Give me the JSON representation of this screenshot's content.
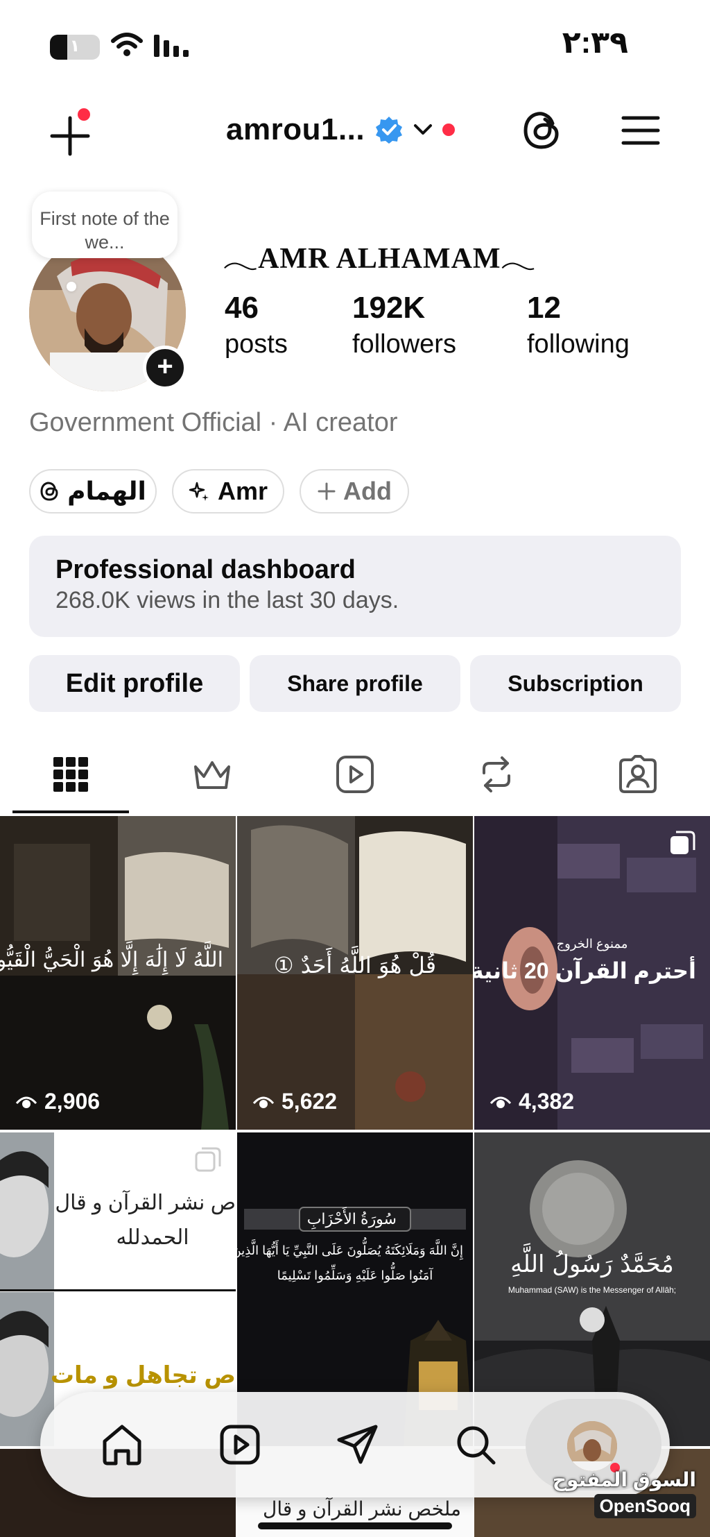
{
  "status_bar": {
    "time": "٢:٣٩",
    "battery_label": "١",
    "battery_level": 0.35
  },
  "header": {
    "username": "amrou1...",
    "verified_icon": "verified-badge-icon",
    "dropdown_icon": "chevron-down-icon",
    "create_icon": "plus-icon",
    "threads_icon": "threads-icon",
    "menu_icon": "hamburger-menu-icon"
  },
  "profile": {
    "note_text": "First note of the we...",
    "display_name": "𓂃AMR ALHAMAM𓂃",
    "stats": [
      {
        "value": "46",
        "label": "posts"
      },
      {
        "value": "192K",
        "label": "followers"
      },
      {
        "value": "12",
        "label": "following"
      }
    ],
    "category": "Government Official · AI creator"
  },
  "chips": [
    {
      "label": "الهمام",
      "icon": "threads-icon"
    },
    {
      "label": "Amr",
      "icon": "sparkle-icon"
    },
    {
      "label": "Add",
      "icon": "plus-icon"
    }
  ],
  "dashboard": {
    "title": "Professional dashboard",
    "subtitle": "268.0K views in the last 30 days."
  },
  "actions": {
    "edit": "Edit profile",
    "share": "Share profile",
    "subscription": "Subscription"
  },
  "tabs": [
    {
      "name": "posts",
      "icon": "grid-icon",
      "active": true
    },
    {
      "name": "subscriptions",
      "icon": "crown-icon",
      "active": false
    },
    {
      "name": "reels",
      "icon": "reels-icon",
      "active": false
    },
    {
      "name": "reposts",
      "icon": "repost-icon",
      "active": false
    },
    {
      "name": "tagged",
      "icon": "tagged-icon",
      "active": false
    }
  ],
  "grid": [
    {
      "views": "2,906",
      "caption": "اللَّهُ لَا إِلَٰهَ إِلَّا هُوَ الْحَيُّ الْقَيُّومُ"
    },
    {
      "views": "5,622",
      "caption": "قُلْ هُوَ اللَّهُ أَحَدٌ ①"
    },
    {
      "views": "4,382",
      "caption": "أحترم القرآن 20 ثانية",
      "small": "ممنوع الخروج"
    },
    {
      "caption": "ص نشر القرآن و قال",
      "caption2": "الحمدلله",
      "caption3": "ص تجاهل و مات"
    },
    {
      "caption": "سُورَةُ الأَحْزَابِ",
      "caption2": "إِنَّ اللَّهَ وَمَلَائِكَتَهُ يُصَلُّونَ عَلَى النَّبِيِّ يَا أَيُّهَا الَّذِينَ",
      "caption3": "آمَنُوا صَلُّوا عَلَيْهِ وَسَلِّمُوا تَسْلِيمًا"
    },
    {
      "caption": "مُحَمَّدٌ رَسُولُ اللَّهِ",
      "small": "Muhammad (SAW) is the Messenger of Allāh;"
    },
    {
      "caption": ""
    },
    {
      "caption": ""
    },
    {
      "caption": "ملخص نشر القرآن و قال"
    }
  ],
  "bottom_nav": [
    {
      "name": "home",
      "icon": "home-icon"
    },
    {
      "name": "reels",
      "icon": "reels-icon"
    },
    {
      "name": "messages",
      "icon": "send-icon"
    },
    {
      "name": "search",
      "icon": "search-icon"
    },
    {
      "name": "profile",
      "icon": "profile-avatar"
    }
  ],
  "watermark": {
    "arabic": "السوق المفتوح",
    "english": "OpenSooq"
  },
  "colors": {
    "notification_red": "#ff2d46",
    "verified_blue": "#3797f0",
    "secondary_text": "#737373",
    "button_bg": "#efeff4"
  }
}
